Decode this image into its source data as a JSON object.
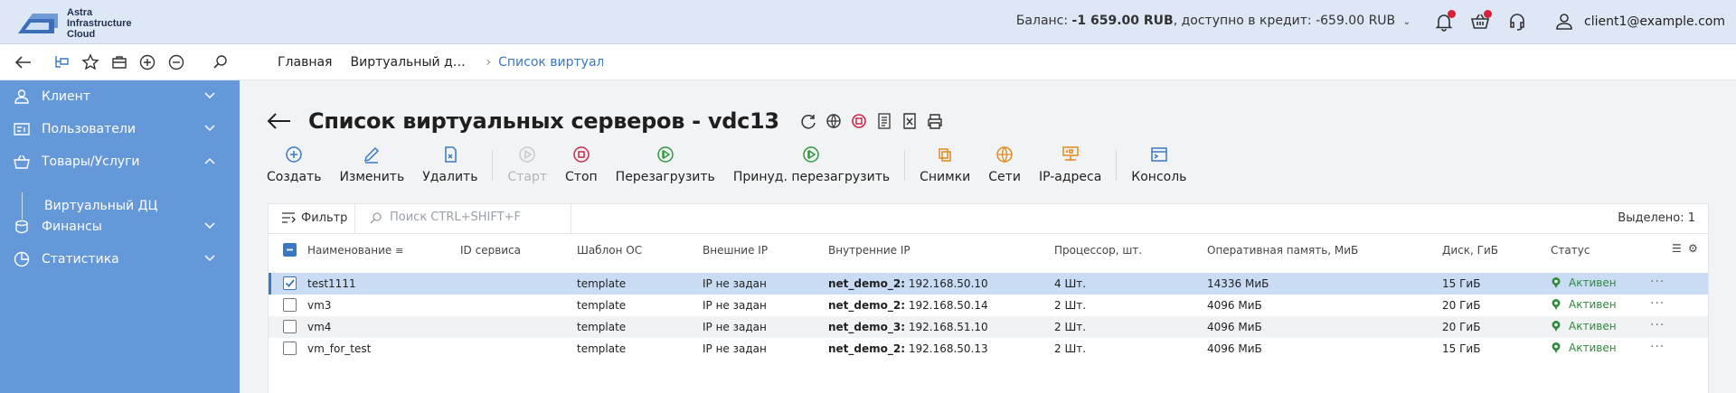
{
  "brand": {
    "line1": "Astra",
    "line2": "Infrastructure",
    "line3": "Cloud"
  },
  "header": {
    "balance_label": "Баланс:",
    "balance_value": "-1 659.00 RUB",
    "credit_label": ", доступно в кредит:",
    "credit_value": "-659.00 RUB",
    "user_email": "client1@example.com"
  },
  "tabs": [
    {
      "label": "Главная"
    },
    {
      "label": "Виртуальный да…"
    },
    {
      "label": "Список виртуаль…",
      "active": true
    }
  ],
  "sidebar": {
    "items": [
      {
        "label": "Клиент",
        "icon": "client-icon"
      },
      {
        "label": "Пользователи",
        "icon": "users-icon"
      },
      {
        "label": "Товары/Услуги",
        "icon": "basket-icon",
        "expanded": true
      },
      {
        "label": "Финансы",
        "icon": "finance-icon"
      },
      {
        "label": "Статистика",
        "icon": "chart-icon"
      }
    ],
    "sub_item": "Виртуальный ДЦ"
  },
  "page": {
    "title": "Список виртуальных серверов - vdc13"
  },
  "actions": [
    {
      "label": "Создать",
      "icon": "plus-circle-icon",
      "color": "#3a78c2"
    },
    {
      "label": "Изменить",
      "icon": "pencil-icon",
      "color": "#3a78c2"
    },
    {
      "label": "Удалить",
      "icon": "delete-icon",
      "color": "#3a78c2"
    },
    {
      "label": "Старт",
      "icon": "play-icon",
      "disabled": true
    },
    {
      "label": "Стоп",
      "icon": "stop-icon",
      "color": "#c8284a"
    },
    {
      "label": "Перезагрузить",
      "icon": "restart-icon",
      "color": "#2e9a3e"
    },
    {
      "label": "Принуд. перезагрузить",
      "icon": "force-restart-icon",
      "color": "#2e9a3e"
    },
    {
      "label": "Снимки",
      "icon": "snapshot-icon",
      "color": "#e08a1e"
    },
    {
      "label": "Сети",
      "icon": "network-icon",
      "color": "#e08a1e"
    },
    {
      "label": "IP-адреса",
      "icon": "ip-icon",
      "color": "#e08a1e"
    },
    {
      "label": "Консоль",
      "icon": "console-icon",
      "color": "#3a78c2"
    }
  ],
  "table": {
    "filter_label": "Фильтр",
    "search_placeholder": "Поиск CTRL+SHIFT+F",
    "selected_text": "Выделено: 1",
    "columns": [
      "Наименование",
      "ID сервиса",
      "Шаблон ОС",
      "Внешние IP",
      "Внутренние IP",
      "Процессор, шт.",
      "Оперативная память, МиБ",
      "Диск, ГиБ",
      "Статус"
    ],
    "rows": [
      {
        "name": "test1111",
        "service_id": "",
        "template": "template",
        "ext_ip": "IP не задан",
        "net": "net_demo_2:",
        "int_ip": " 192.168.50.10",
        "cpu": "4 Шт.",
        "ram": "14336 МиБ",
        "disk": "15 ГиБ",
        "status": "Активен",
        "selected": true
      },
      {
        "name": "vm3",
        "service_id": "",
        "template": "template",
        "ext_ip": "IP не задан",
        "net": "net_demo_2:",
        "int_ip": " 192.168.50.14",
        "cpu": "2 Шт.",
        "ram": "4096 МиБ",
        "disk": "20 ГиБ",
        "status": "Активен"
      },
      {
        "name": "vm4",
        "service_id": "",
        "template": "template",
        "ext_ip": "IP не задан",
        "net": "net_demo_3:",
        "int_ip": " 192.168.51.10",
        "cpu": "2 Шт.",
        "ram": "4096 МиБ",
        "disk": "20 ГиБ",
        "status": "Активен"
      },
      {
        "name": "vm_for_test",
        "service_id": "",
        "template": "template",
        "ext_ip": "IP не задан",
        "net": "net_demo_2:",
        "int_ip": " 192.168.50.13",
        "cpu": "2 Шт.",
        "ram": "4096 МиБ",
        "disk": "15 ГиБ",
        "status": "Активен"
      }
    ]
  },
  "colors": {
    "sidebar": "#6598d8",
    "accent": "#3a78c2",
    "active_status": "#2e8a3c",
    "badge": "#d6213a"
  }
}
